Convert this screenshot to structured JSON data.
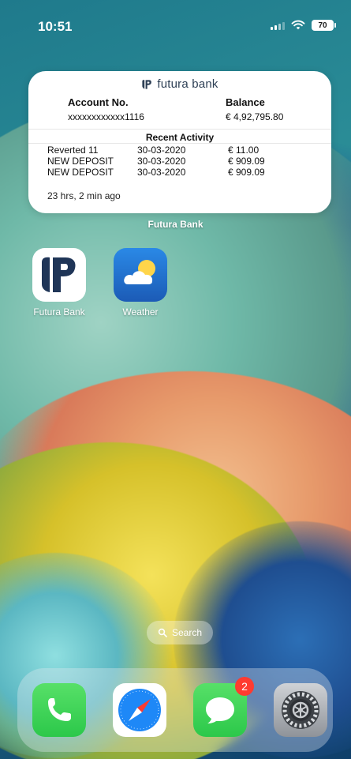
{
  "status_bar": {
    "time": "10:51",
    "battery": "70"
  },
  "widget": {
    "logo_text": "futura bank",
    "account_label": "Account No.",
    "account_value": "xxxxxxxxxxxx1116",
    "balance_label": "Balance",
    "balance_value": "€ 4,92,795.80",
    "recent_title": "Recent Activity",
    "activity": [
      {
        "desc": "Reverted 11",
        "date": "30-03-2020",
        "amount": "€ 11.00"
      },
      {
        "desc": "NEW DEPOSIT",
        "date": "30-03-2020",
        "amount": "€ 909.09"
      },
      {
        "desc": "NEW DEPOSIT",
        "date": "30-03-2020",
        "amount": "€ 909.09"
      }
    ],
    "last_updated": "23 hrs, 2 min ago",
    "widget_title": "Futura Bank"
  },
  "home_apps": [
    {
      "name": "Futura Bank",
      "icon": "futura-bank-icon"
    },
    {
      "name": "Weather",
      "icon": "weather-icon"
    }
  ],
  "search": {
    "label": "Search",
    "icon": "magnifier-icon"
  },
  "dock": {
    "apps": [
      {
        "icon": "phone-icon"
      },
      {
        "icon": "safari-icon"
      },
      {
        "icon": "messages-icon",
        "badge": "2"
      },
      {
        "icon": "settings-icon"
      }
    ]
  },
  "colors": {
    "badge": "#ff3b30",
    "green_app": "#2cc84a",
    "blue_app": "#1c5bb6"
  }
}
